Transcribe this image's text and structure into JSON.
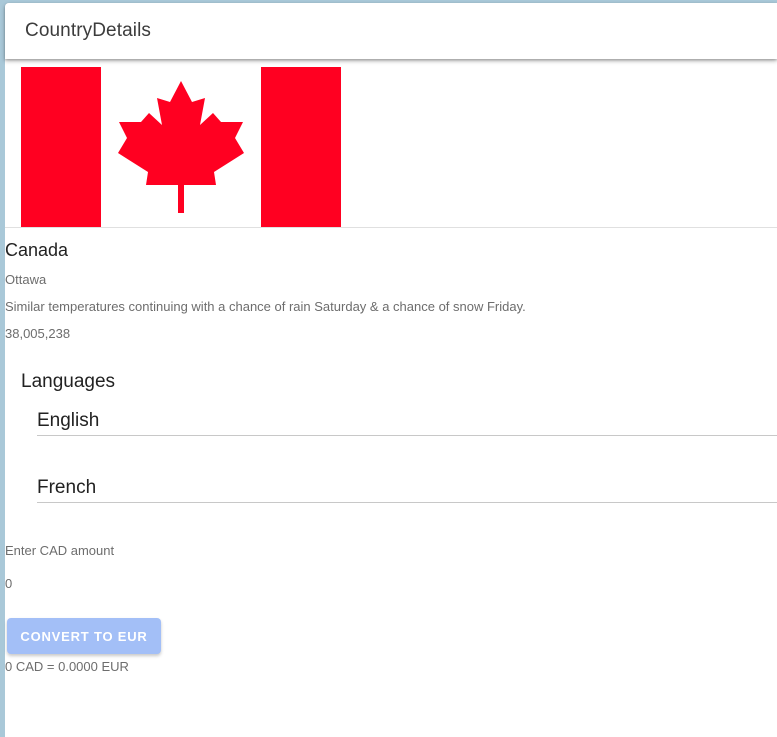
{
  "app": {
    "title": "CountryDetails"
  },
  "country": {
    "name": "Canada",
    "capital": "Ottawa",
    "weather": "Similar temperatures continuing with a chance of rain Saturday & a chance of snow Friday.",
    "population": "38,005,238"
  },
  "languages": {
    "heading": "Languages",
    "items": [
      "English",
      "French"
    ]
  },
  "converter": {
    "label": "Enter CAD amount",
    "value": "0",
    "button_label": "CONVERT TO EUR",
    "result": "0 CAD = 0.0000 EUR"
  },
  "colors": {
    "flag_red": "#ff0021",
    "button": "#a3bff7",
    "page_background": "#a9c8d8"
  }
}
